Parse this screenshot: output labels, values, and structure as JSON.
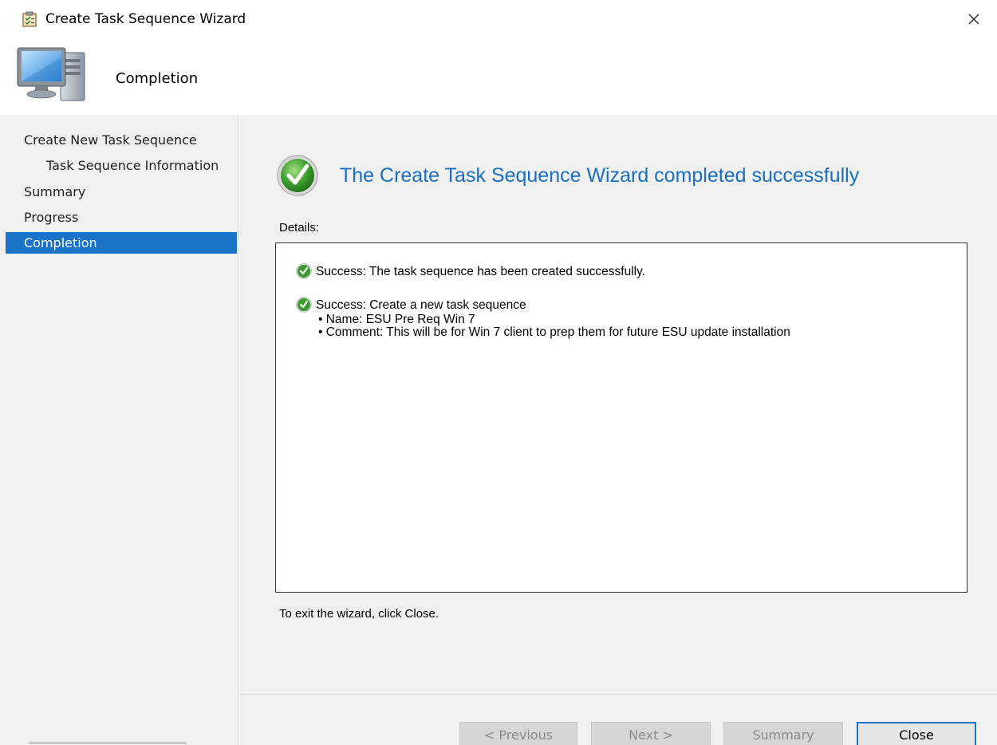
{
  "window": {
    "title": "Create Task Sequence Wizard"
  },
  "header": {
    "title": "Completion"
  },
  "sidebar": {
    "items": [
      {
        "label": "Create New Task Sequence",
        "level": 0,
        "active": false
      },
      {
        "label": "Task Sequence Information",
        "level": 1,
        "active": false
      },
      {
        "label": "Summary",
        "level": 0,
        "active": false
      },
      {
        "label": "Progress",
        "level": 0,
        "active": false
      },
      {
        "label": "Completion",
        "level": 0,
        "active": true
      }
    ]
  },
  "main": {
    "success_title": "The Create Task Sequence Wizard completed successfully",
    "details_label": "Details:",
    "entries": [
      {
        "text": "Success: The task sequence has been created successfully.",
        "bullets": []
      },
      {
        "text": "Success: Create a new task sequence",
        "bullets": [
          "Name: ESU Pre Req Win 7",
          "Comment: This will be for Win 7 client to prep them for future ESU update installation"
        ]
      }
    ],
    "exit_text": "To exit the wizard, click Close."
  },
  "footer": {
    "previous_label": "< Previous",
    "next_label": "Next >",
    "summary_label": "Summary",
    "close_label": "Close"
  },
  "colors": {
    "accent": "#1a73c6",
    "title_blue": "#1a6fc4",
    "success_green": "#3c9a2e"
  },
  "icons": {
    "window": "clipboard-wizard-icon",
    "header": "computer-icon",
    "success": "check-circle-icon",
    "close": "close-icon"
  }
}
